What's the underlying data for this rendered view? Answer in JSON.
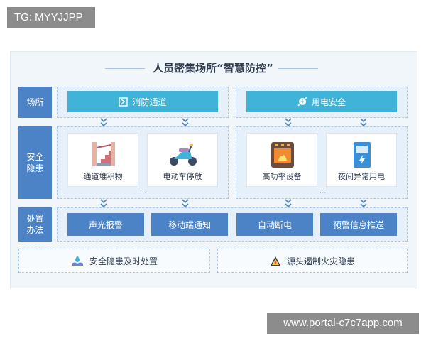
{
  "top_tag": "TG: MYYJJPP",
  "title": "人员密集场所“智慧防控”",
  "rows": {
    "place": "场所",
    "hazard": "安全\n隐患",
    "action": "处置\n办法"
  },
  "places": [
    "消防通道",
    "用电安全"
  ],
  "hazards": {
    "left": [
      "通道堆积物",
      "电动车停放"
    ],
    "right": [
      "高功率设备",
      "夜间异常用电"
    ],
    "ellipsis": "..."
  },
  "actions": [
    "声光报警",
    "移动端通知",
    "自动断电",
    "预警信息推送"
  ],
  "outcomes": [
    "安全隐患及时处置",
    "源头遏制火灾隐患"
  ],
  "icons": {
    "place_left": "fire-exit-icon",
    "place_right": "electric-plug-icon",
    "outcome_left": "hands-water-icon",
    "outcome_right": "warning-triangle-icon"
  },
  "colors": {
    "primary_blue": "#4b83c6",
    "cyan": "#3fb3d8",
    "panel_bg": "#f1f6fb"
  },
  "bottom_watermark": "www.portal-c7c7app.com"
}
